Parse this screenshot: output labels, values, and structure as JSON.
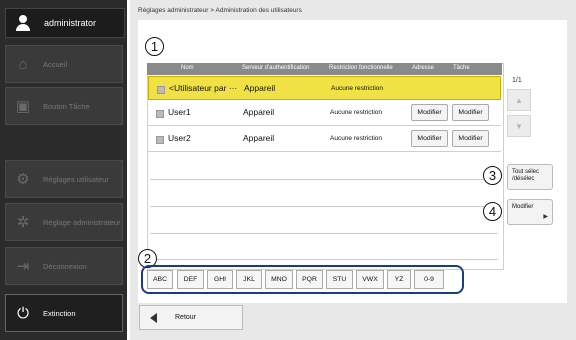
{
  "sidebar": {
    "user": "administrator",
    "items": [
      {
        "label": "Accueil",
        "icon": "home-icon"
      },
      {
        "label": "Bouton Tâche",
        "icon": "task-button-icon"
      },
      {
        "label": "Réglages utilisateur",
        "icon": "user-settings-icon"
      },
      {
        "label": "Réglage administrateur",
        "icon": "admin-settings-icon"
      },
      {
        "label": "Déconnexion",
        "icon": "logout-icon"
      },
      {
        "label": "Extinction",
        "icon": "power-icon"
      }
    ]
  },
  "breadcrumb": "Réglages administrateur > Administration des utilisateurs",
  "table": {
    "headers": [
      "Nom",
      "Serveur d'authentification",
      "Restriction fonctionnelle",
      "Adresse",
      "Tâche"
    ],
    "rows": [
      {
        "name": "<Utilisateur par ···",
        "server": "Appareil",
        "restriction": "Aucune restriction",
        "address_btn": "",
        "task_btn": "",
        "selected": true
      },
      {
        "name": "User1",
        "server": "Appareil",
        "restriction": "Aucune restriction",
        "address_btn": "Modifier",
        "task_btn": "Modifier",
        "selected": false
      },
      {
        "name": "User2",
        "server": "Appareil",
        "restriction": "Aucune restriction",
        "address_btn": "Modifier",
        "task_btn": "Modifier",
        "selected": false
      }
    ]
  },
  "pager": {
    "text": "1/1"
  },
  "actions": {
    "select_all": "Tout sélec /désélec",
    "modify": "Modifier"
  },
  "filters": [
    "ABC",
    "DEF",
    "GHI",
    "JKL",
    "MNO",
    "PQR",
    "STU",
    "VWX",
    "YZ",
    "0-9"
  ],
  "callouts": [
    "1",
    "2",
    "3",
    "4"
  ],
  "back": "Retour",
  "colors": {
    "selected_row": "#f0e245",
    "sidebar": "#2b2b2b",
    "callout_border": "#1e3c7d"
  }
}
